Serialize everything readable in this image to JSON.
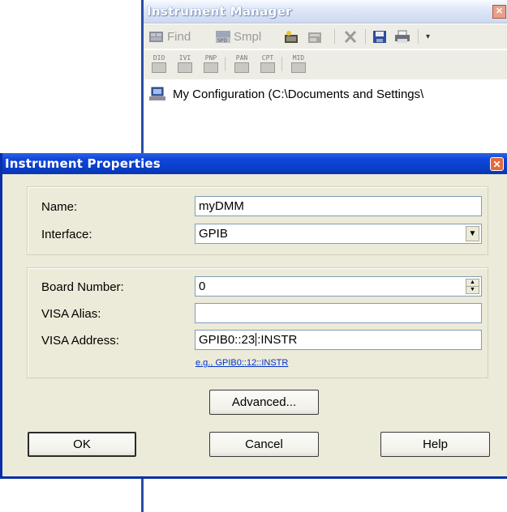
{
  "manager_window": {
    "title": "Instrument Manager",
    "close_glyph": "✕",
    "toolbar1": {
      "find_label": "Find",
      "smpl_label": "Smpl",
      "spd_tag": "SPD"
    },
    "toolbar2": {
      "buttons": [
        "DIO",
        "IVI",
        "PNP",
        "PAN",
        "CPT",
        "MID"
      ]
    },
    "tree": {
      "root_label": "My Configuration (C:\\Documents and Settings\\"
    }
  },
  "dialog": {
    "title": "Instrument Properties",
    "close_glyph": "✕",
    "name_label": "Name:",
    "name_value": "myDMM",
    "interface_label": "Interface:",
    "interface_value": "GPIB",
    "board_label": "Board Number:",
    "board_value": "0",
    "alias_label": "VISA Alias:",
    "alias_value": "",
    "address_label": "VISA Address:",
    "address_value_before_caret": "GPIB0::23",
    "address_value_after_caret": ":INSTR",
    "address_example": "e.g., GPIB0::12::INSTR",
    "advanced_label": "Advanced...",
    "ok_label": "OK",
    "cancel_label": "Cancel",
    "help_label": "Help"
  },
  "colors": {
    "dialog_title": "#0a3fc8",
    "dialog_face": "#ecead8",
    "manager_title": "#dfe8f7",
    "link": "#0033cc"
  }
}
